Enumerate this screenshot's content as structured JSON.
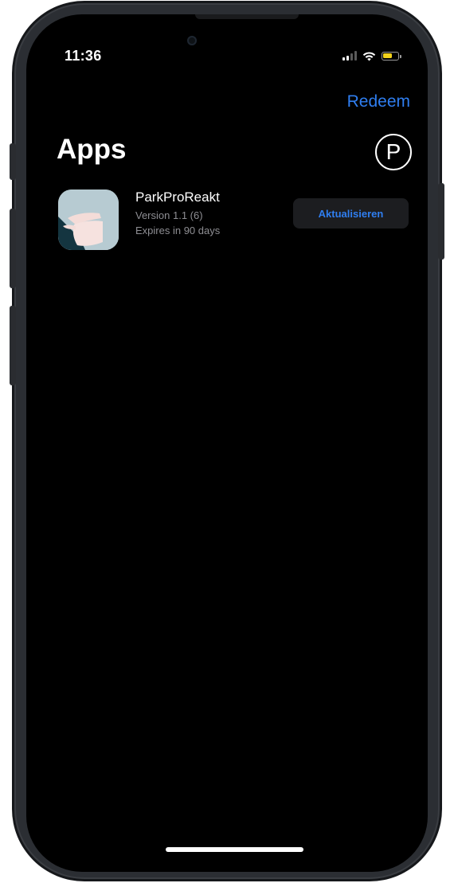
{
  "status_bar": {
    "time": "11:36",
    "icons": [
      "signal-icon",
      "wifi-icon",
      "battery-icon"
    ],
    "battery_color": "#f2d21b"
  },
  "nav": {
    "redeem_label": "Redeem",
    "profile_icon_label": "P"
  },
  "page": {
    "title": "Apps"
  },
  "apps": [
    {
      "name": "ParkProReakt",
      "version": "Version 1.1 (6)",
      "expiry": "Expires in 90 days",
      "action_label": "Aktualisieren"
    }
  ],
  "colors": {
    "accent": "#2f7ef0",
    "background": "#000000",
    "secondary_text": "#8e8e93",
    "button_bg": "#1c1d20"
  }
}
